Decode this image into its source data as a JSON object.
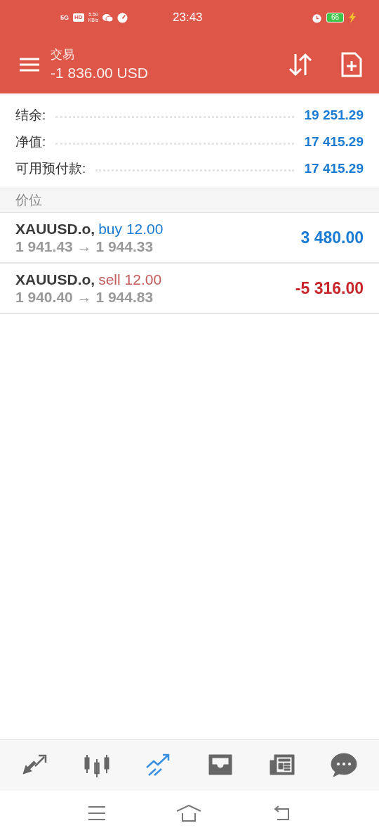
{
  "status_bar": {
    "network": "5G",
    "hd": "HD",
    "speed": [
      "5.50",
      "KB/s"
    ],
    "time": "23:43",
    "battery": "66"
  },
  "header": {
    "title": "交易",
    "subtitle": "-1 836.00 USD"
  },
  "summary": [
    {
      "label": "结余:",
      "value": "19 251.29"
    },
    {
      "label": "净值:",
      "value": "17 415.29"
    },
    {
      "label": "可用预付款:",
      "value": "17 415.29"
    }
  ],
  "section": {
    "title": "价位"
  },
  "positions": [
    {
      "symbol": "XAUUSD.o,",
      "kind": "buy",
      "action": "buy 12.00",
      "prices": "1 941.43 → 1 944.33",
      "profit": "3 480.00"
    },
    {
      "symbol": "XAUUSD.o,",
      "kind": "sell",
      "action": "sell 12.00",
      "prices": "1 940.40 → 1 944.83",
      "profit": "-5 316.00"
    }
  ],
  "bottom_nav": [
    {
      "kind": "trade",
      "selected": false
    },
    {
      "kind": "chart",
      "selected": false
    },
    {
      "kind": "positions",
      "selected": true
    },
    {
      "kind": "inbox",
      "selected": false
    },
    {
      "kind": "news",
      "selected": false
    },
    {
      "kind": "chat",
      "selected": false
    }
  ]
}
